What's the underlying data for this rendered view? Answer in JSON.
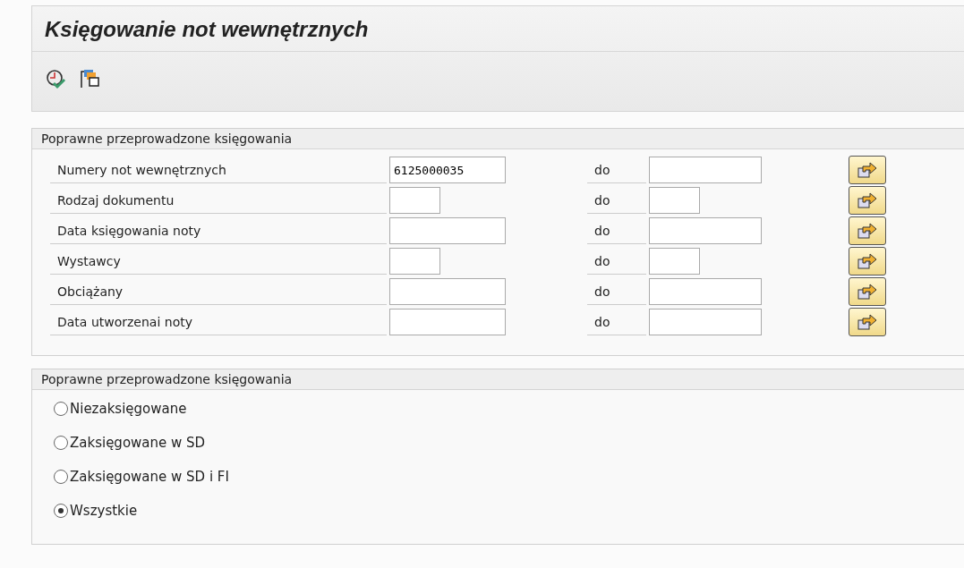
{
  "window": {
    "title": "Księgowanie not wewnętrznych"
  },
  "toolbar": {
    "buttons": [
      {
        "kind": "execute"
      },
      {
        "kind": "copy"
      }
    ]
  },
  "selection": {
    "title": "Poprawne przeprowadzone księgowania",
    "rows": [
      {
        "label": "Numery not wewnętrznych",
        "kind": "wide",
        "from_value": "6125000035",
        "to_label": "do"
      },
      {
        "label": "Rodzaj dokumentu",
        "kind": "narrow",
        "to_label": "do"
      },
      {
        "label": "Data księgowania noty",
        "kind": "wide",
        "to_label": "do"
      },
      {
        "label": "Wystawcy",
        "kind": "narrow",
        "to_label": "do"
      },
      {
        "label": "Obciążany",
        "kind": "wide",
        "to_label": "do"
      },
      {
        "label": "Data utworzenai noty",
        "kind": "wide",
        "to_label": "do"
      }
    ]
  },
  "status": {
    "title": "Poprawne przeprowadzone księgowania",
    "options": [
      {
        "label": "Niezaksięgowane",
        "selected": false
      },
      {
        "label": "Zaksięgowane w SD",
        "selected": false
      },
      {
        "label": "Zaksięgowane w SD i FI",
        "selected": false
      },
      {
        "label": "Wszystkie",
        "selected": true
      }
    ]
  }
}
